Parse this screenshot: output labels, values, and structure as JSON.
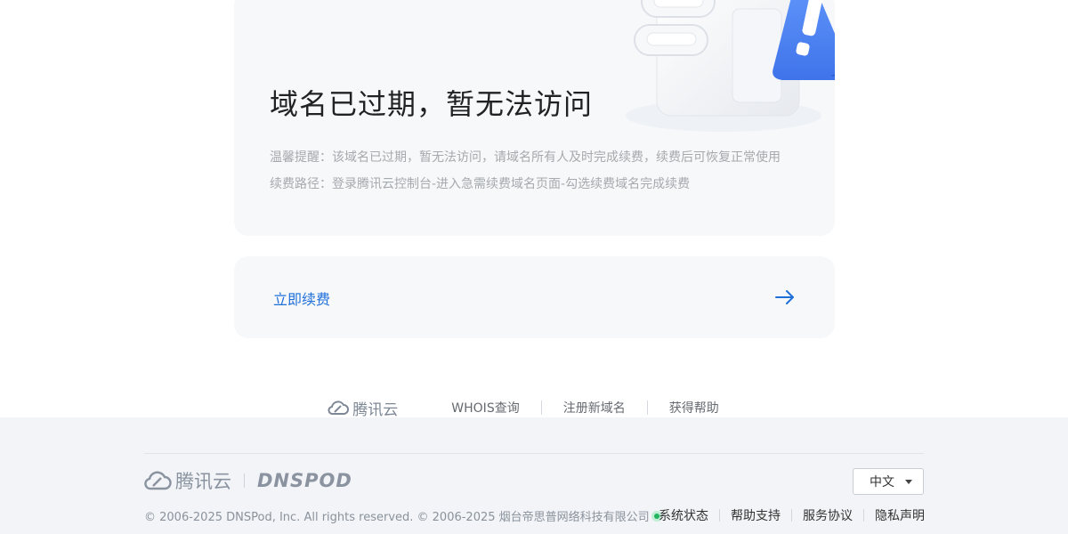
{
  "notice_card": {
    "title": "域名已过期，暂无法访问",
    "notice": "温馨提醒：该域名已过期，暂无法访问，请域名所有人及时完成续费，续费后可恢复正常使用",
    "renew_path": "续费路径：登录腾讯云控制台-进入急需续费域名页面-勾选续费域名完成续费"
  },
  "renew_card": {
    "label": "立即续费",
    "arrow_icon": "arrow-right-icon",
    "color": "#1f6fd9"
  },
  "links_bar": {
    "brand": "腾讯云",
    "links": [
      "WHOIS查询",
      "注册新域名",
      "获得帮助"
    ]
  },
  "footer": {
    "tencent_cloud": "腾讯云",
    "dnspod": "DNSPOD",
    "language": "中文",
    "copyright": "© 2006-2025 DNSPod, Inc. All rights reserved. © 2006-2025 烟台帝思普网络科技有限公司",
    "links": [
      "系统状态",
      "帮助支持",
      "服务协议",
      "隐私声明"
    ],
    "status_color": "#22b35e"
  }
}
